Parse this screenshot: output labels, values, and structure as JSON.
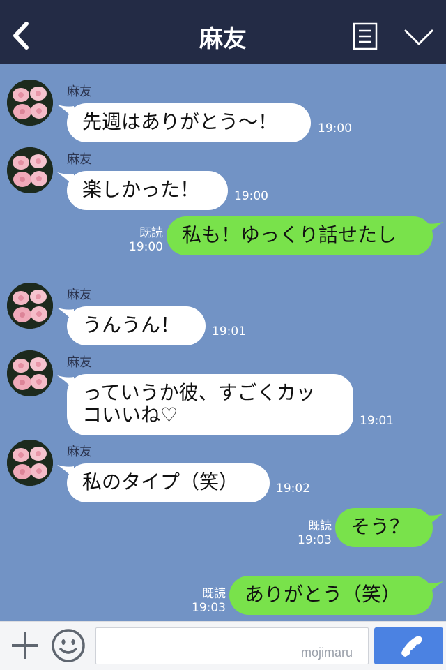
{
  "header": {
    "title": "麻友"
  },
  "colors": {
    "header": "#232b45",
    "background": "#7293c5",
    "incoming": "#ffffff",
    "outgoing": "#79e24b",
    "send": "#4b82e2"
  },
  "icons": {
    "back": "chevron-left-icon",
    "menu": "list-icon",
    "collapse": "chevron-down-icon",
    "plus": "plus-icon",
    "emoji": "smiley-icon",
    "call": "phone-icon"
  },
  "messages": [
    {
      "direction": "in",
      "sender": "麻友",
      "lines": [
        "先週はありがとう～！"
      ],
      "time": "19:00"
    },
    {
      "direction": "in",
      "sender": "麻友",
      "lines": [
        "楽しかった！"
      ],
      "time": "19:00"
    },
    {
      "direction": "out",
      "read": "既読",
      "lines": [
        "私も！ゆっくり話せたし"
      ],
      "time": "19:00"
    },
    {
      "direction": "in",
      "sender": "麻友",
      "lines": [
        "うんうん！"
      ],
      "time": "19:01"
    },
    {
      "direction": "in",
      "sender": "麻友",
      "lines": [
        "っていうか彼、すごくカッ",
        "コいいね♡"
      ],
      "time": "19:01"
    },
    {
      "direction": "in",
      "sender": "麻友",
      "lines": [
        "私のタイプ（笑）"
      ],
      "time": "19:02"
    },
    {
      "direction": "out",
      "read": "既読",
      "lines": [
        "そう？"
      ],
      "time": "19:03"
    },
    {
      "direction": "out",
      "read": "既読",
      "lines": [
        "ありがとう（笑）"
      ],
      "time": "19:03"
    }
  ],
  "footer": {
    "input_value": "",
    "watermark": "mojimaru"
  }
}
